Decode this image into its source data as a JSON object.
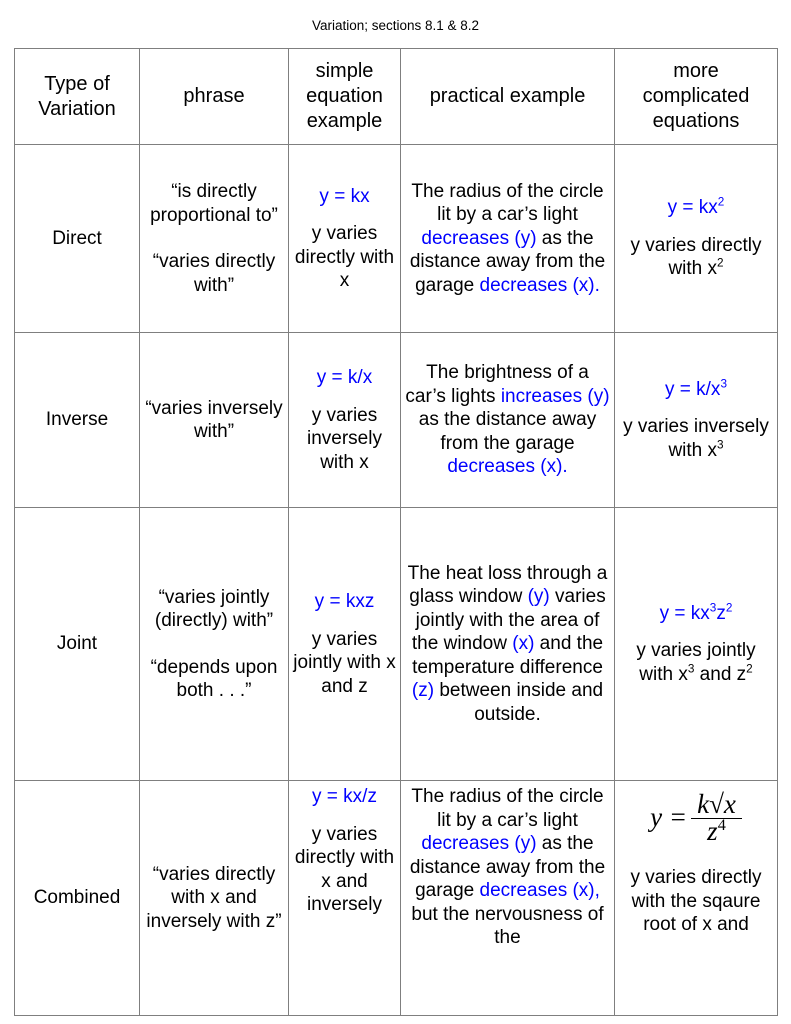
{
  "document": {
    "title": "Variation; sections 8.1 & 8.2",
    "accent_blue": "#0000FF",
    "border_color": "#7F7F7F"
  },
  "table": {
    "headers": {
      "type_of_variation": "Type of Variation",
      "phrase": "phrase",
      "simple_equation_example": "simple equation example",
      "practical_example": "practical example",
      "more_complicated_equations": "more complicated equations"
    },
    "rows": [
      {
        "type": "Direct",
        "phrase_part1": "“is directly proportional to”",
        "phrase_part2": "“varies directly with”",
        "simple_equation": "y = kx",
        "simple_desc": "y varies directly with x",
        "practical_example": {
          "seg1": "The radius of the circle lit by a car’s light ",
          "seg2_blue": "decreases (y)",
          "seg3": " as the distance away from the garage ",
          "seg4_blue": "decreases (x)."
        },
        "complicated_equation": "y = kx",
        "complicated_equation_sup": "2",
        "complicated_desc_pre": "y varies directly with x",
        "complicated_desc_sup": "2"
      },
      {
        "type": "Inverse",
        "phrase_part1": "“varies inversely with”",
        "phrase_part2": "",
        "simple_equation": "y = k/x",
        "simple_desc": "y varies inversely with x",
        "practical_example": {
          "seg1": "The brightness of a car’s lights ",
          "seg2_blue": "increases (y)",
          "seg3": "  as the distance away from the garage ",
          "seg4_blue": "decreases (x)."
        },
        "complicated_equation": "y = k/x",
        "complicated_equation_sup": "3",
        "complicated_desc_pre": "y varies inversely with x",
        "complicated_desc_sup": "3"
      },
      {
        "type": "Joint",
        "phrase_part1": "“varies jointly (directly) with”",
        "phrase_part2": "“depends upon both . . .”",
        "simple_equation": "y = kxz",
        "simple_desc": "y varies jointly with x and z",
        "practical_example": {
          "seg1": "The heat loss through a glass window ",
          "seg2_blue": "(y)",
          "seg3": " varies jointly with the area of the window ",
          "seg4_blue": "(x)",
          "seg5": " and the temperature difference ",
          "seg6_blue": "(z)",
          "seg7": " between inside and outside."
        },
        "complicated_equation": "y = kx",
        "complicated_equation_sup": "3",
        "complicated_equation_tail": "z",
        "complicated_equation_sup2": "2",
        "complicated_desc_pre": "y varies jointly with x",
        "complicated_desc_sup": "3",
        "complicated_desc_mid": " and z",
        "complicated_desc_sup2": "2"
      },
      {
        "type": "Combined",
        "phrase_part1": "“varies directly with x and inversely with z”",
        "phrase_part2": "",
        "simple_equation": "y = kx/z",
        "simple_desc": "y varies directly with x and inversely",
        "practical_example": {
          "seg1": "The radius of the circle lit by a car’s light ",
          "seg2_blue": "decreases (y)",
          "seg3": " as the distance away from the garage ",
          "seg4_blue": "decreases (x),",
          "seg5": " but the nervousness of the"
        },
        "complicated_equation_math": {
          "lhs": "y =",
          "numerator_k": "k",
          "numerator_radical": "√",
          "numerator_x": "x",
          "denominator_z": "z",
          "denominator_exp": "4"
        },
        "complicated_desc": "y varies directly with the sqaure root of x and"
      }
    ]
  }
}
